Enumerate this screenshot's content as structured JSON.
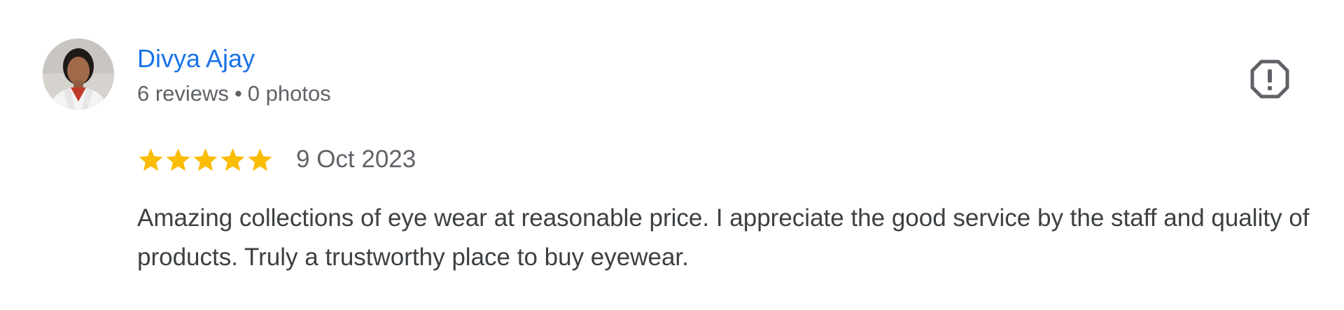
{
  "review": {
    "author": {
      "name": "Divya Ajay",
      "reviews_count": "6 reviews",
      "separator": "•",
      "photos_count": "0 photos",
      "avatar_icon": "profile-photo"
    },
    "rating": {
      "stars": 5,
      "max_stars": 5,
      "star_color": "#fbbc04"
    },
    "date": "9 Oct 2023",
    "text": "Amazing collections of eye wear at reasonable price. I appreciate the good service by the staff and quality of products. Truly a trustworthy place to buy eyewear.",
    "report_icon": "report-flag-icon"
  },
  "colors": {
    "author_name": "#1a73e8",
    "meta": "#5f6368",
    "body_text": "#3c4043",
    "icon": "#5f6368"
  }
}
